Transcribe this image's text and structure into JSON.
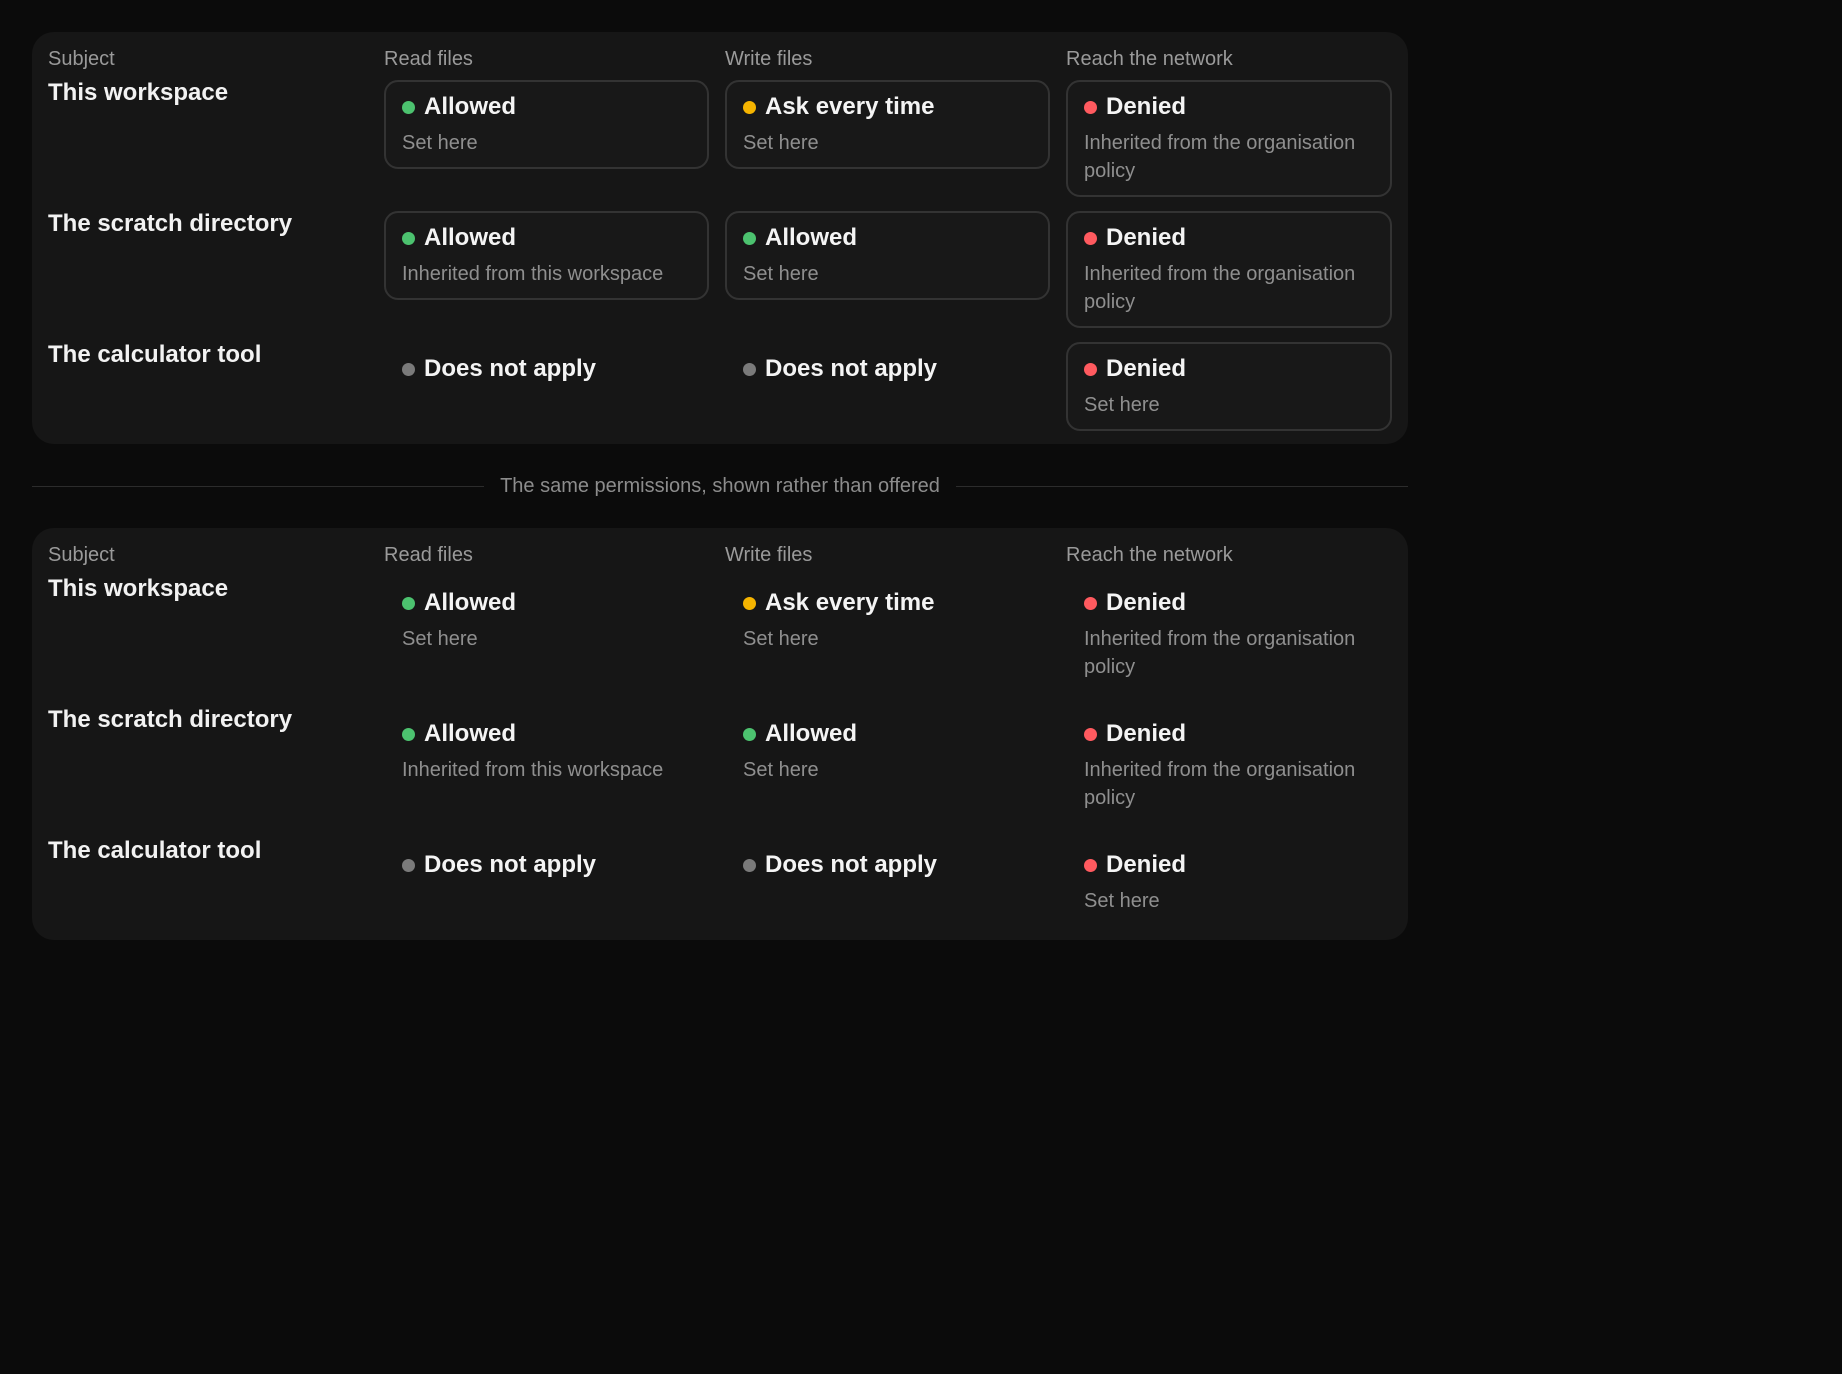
{
  "colors": {
    "allowed": "#4cc26f",
    "ask": "#f5b400",
    "denied": "#ff5a5f",
    "na": "#7a7a7a"
  },
  "headers": {
    "subject": "Subject",
    "read": "Read files",
    "write": "Write files",
    "network": "Reach the network"
  },
  "divider_label": "The same permissions, shown rather than offered",
  "rows": [
    {
      "subject": "This workspace",
      "read": {
        "status": "Allowed",
        "kind": "allowed",
        "note": "Set here"
      },
      "write": {
        "status": "Ask every time",
        "kind": "ask",
        "note": "Set here"
      },
      "network": {
        "status": "Denied",
        "kind": "denied",
        "note": "Inherited from the organisation policy"
      }
    },
    {
      "subject": "The scratch directory",
      "read": {
        "status": "Allowed",
        "kind": "allowed",
        "note": "Inherited from this workspace"
      },
      "write": {
        "status": "Allowed",
        "kind": "allowed",
        "note": "Set here"
      },
      "network": {
        "status": "Denied",
        "kind": "denied",
        "note": "Inherited from the organisation policy"
      }
    },
    {
      "subject": "The calculator tool",
      "read": {
        "status": "Does not apply",
        "kind": "na",
        "note": ""
      },
      "write": {
        "status": "Does not apply",
        "kind": "na",
        "note": ""
      },
      "network": {
        "status": "Denied",
        "kind": "denied",
        "note": "Set here"
      }
    }
  ]
}
